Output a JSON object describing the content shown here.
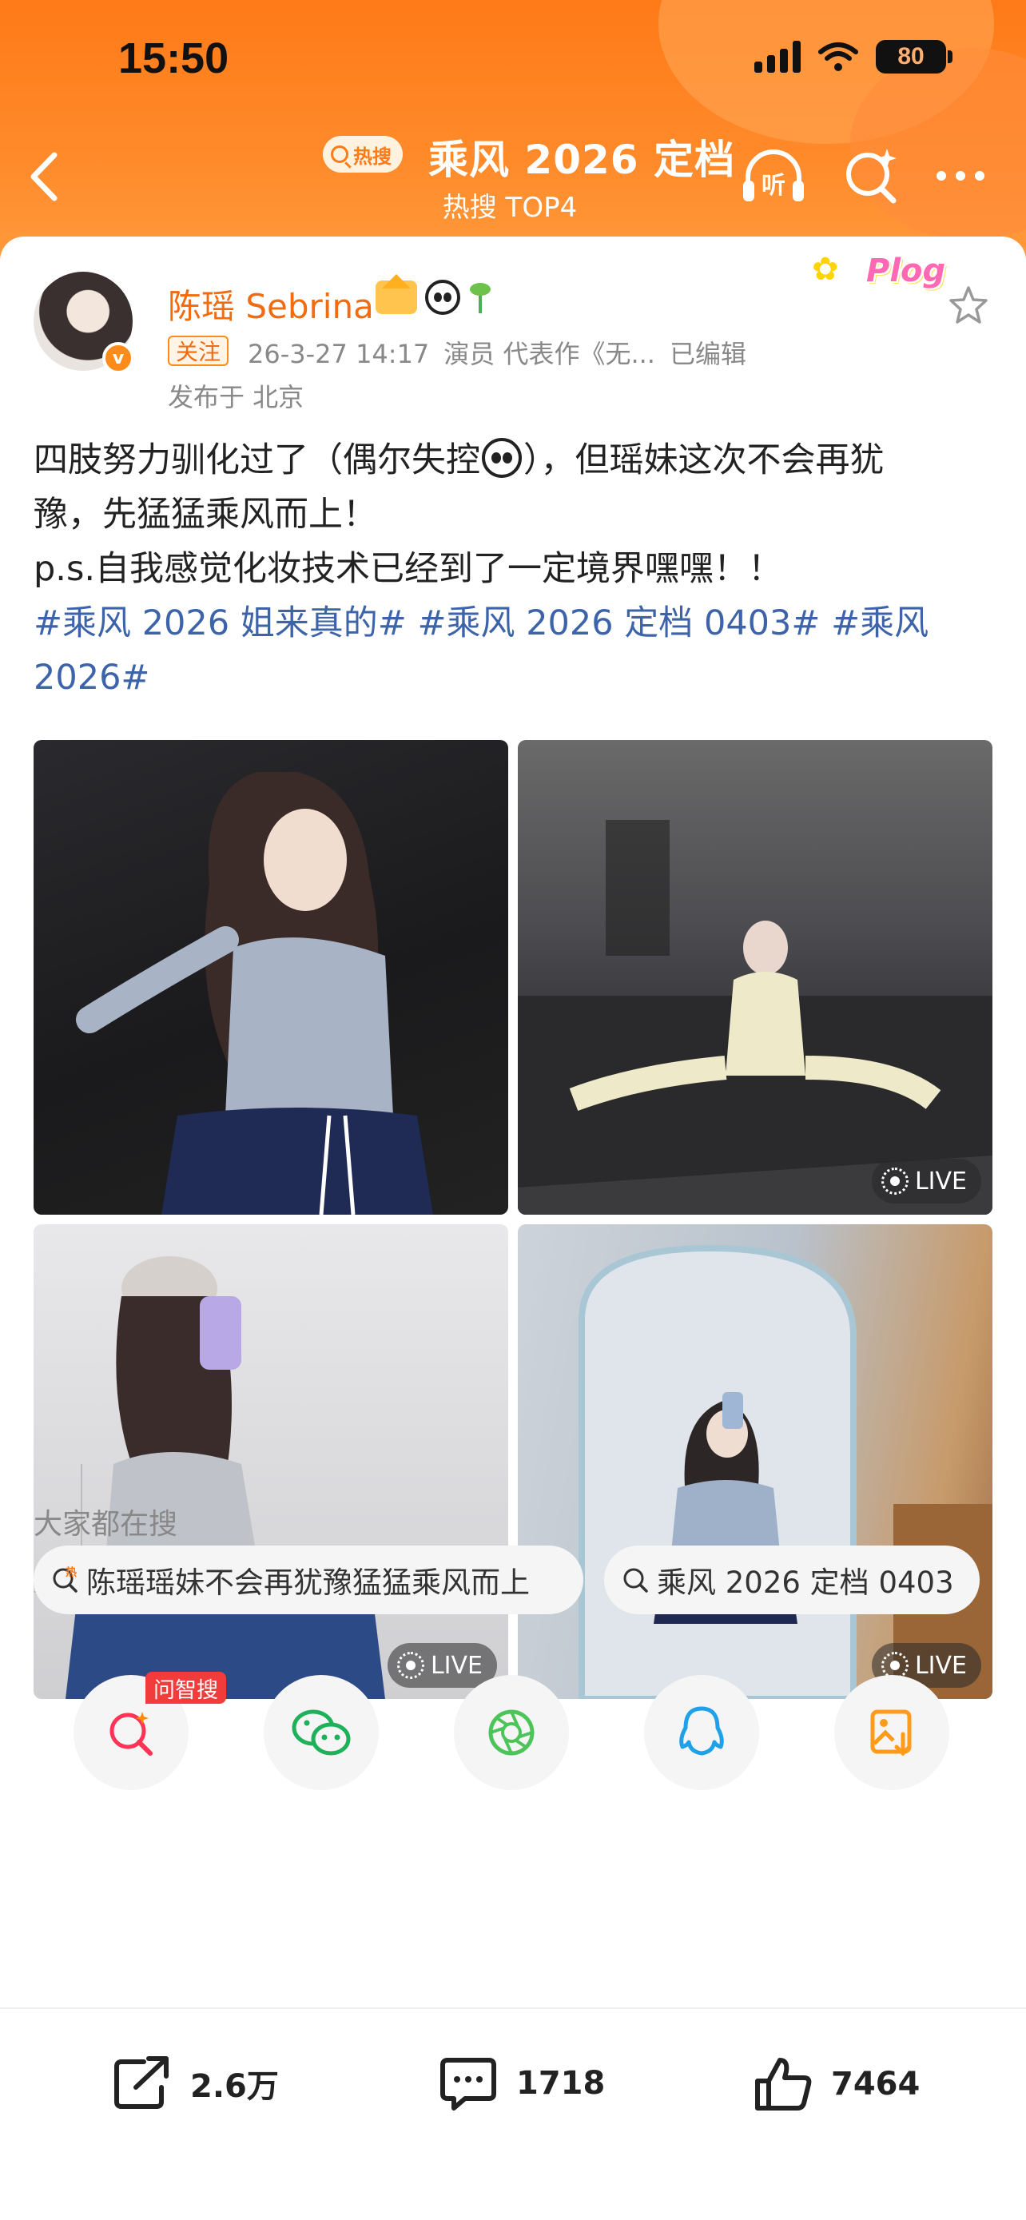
{
  "status_bar": {
    "time": "15:50",
    "battery": "80"
  },
  "header": {
    "hot_badge": "热搜",
    "title": "乘风 2026 定档",
    "subtitle": "热搜 TOP4",
    "listen_label": "听",
    "accent_color": "#ff7a18"
  },
  "post": {
    "user_name": "陈瑶 Sebrina",
    "follow_tag": "关注",
    "timestamp": "26-3-27 14:17",
    "role": "演员 代表作《无...",
    "edited": "已编辑",
    "location": "发布于 北京",
    "sticker_text": "Plog",
    "text_line1_a": "四肢努力驯化过了（偶尔失控",
    "text_line1_b": "），但瑶妹这次不会再犹",
    "text_line2": "豫，先猛猛乘风而上！",
    "text_line3": "p.s.自我感觉化妆技术已经到了一定境界嘿嘿！！",
    "tag1": "#乘风 2026 姐来真的#",
    "tag2": "#乘风 2026 定档 0403#",
    "tag3_a": "#乘风",
    "tag3_b": "2026#",
    "live_label": "LIVE"
  },
  "search_section": {
    "title": "大家都在搜",
    "chips": [
      "陈瑶瑶妹不会再犹豫猛猛乘风而上",
      "乘风 2026 定档 0403"
    ],
    "hot_mark": "热"
  },
  "share_row": {
    "ask_badge": "问智搜"
  },
  "actions": {
    "repost": "2.6万",
    "comment": "1718",
    "like": "7464"
  }
}
